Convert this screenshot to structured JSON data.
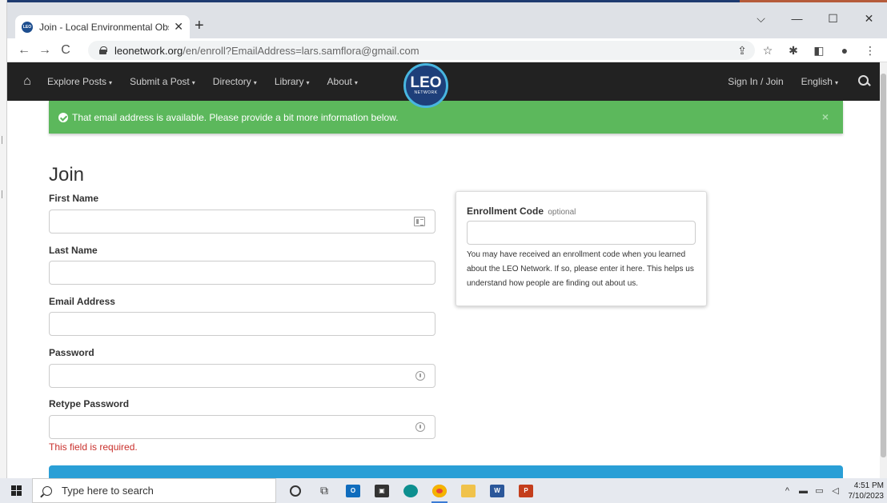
{
  "browser": {
    "tab_title": "Join - Local Environmental Obser",
    "tab_close": "✕",
    "new_tab": "+",
    "url_host": "leonetwork.org",
    "url_path": "/en/enroll?EmailAddress=lars.samflora@gmail.com",
    "controls": {
      "dropdown": "⌵",
      "minimize": "—",
      "maximize": "☐",
      "close": "✕"
    },
    "nav": {
      "back": "←",
      "forward": "→",
      "reload": "C"
    },
    "favicon_text": "LEO"
  },
  "site_nav": {
    "items": [
      {
        "label": "Explore Posts"
      },
      {
        "label": "Submit a Post"
      },
      {
        "label": "Directory"
      },
      {
        "label": "Library"
      },
      {
        "label": "About"
      }
    ],
    "logo_main": "LEO",
    "logo_sub": "NETWORK",
    "sign_in": "Sign In / Join",
    "language": "English",
    "caret": "▾"
  },
  "alert": {
    "message": "That email address is available. Please provide a bit more information below.",
    "close": "×",
    "color": "#5cb85c"
  },
  "form": {
    "title": "Join",
    "first_name_label": "First Name",
    "last_name_label": "Last Name",
    "email_label": "Email Address",
    "password_label": "Password",
    "retype_password_label": "Retype Password",
    "error": "This field is required.",
    "first_name_value": "",
    "last_name_value": "",
    "email_value": "",
    "password_value": "",
    "retype_password_value": ""
  },
  "enrollment": {
    "label": "Enrollment Code",
    "optional": "optional",
    "value": "",
    "help": "You may have received an enrollment code when you learned about the LEO Network. If so, please enter it here. This helps us understand how people are finding out about us."
  },
  "taskbar": {
    "search_placeholder": "Type here to search",
    "time": "4:51 PM",
    "date": "7/10/2023",
    "apps": [
      "cortana",
      "task-view",
      "outlook",
      "store",
      "edge",
      "chrome",
      "file-explorer",
      "word",
      "powerpoint"
    ]
  },
  "colors": {
    "navbar": "#222222",
    "accent_blue": "#2a9fd6",
    "error_red": "#c9302c",
    "logo_blue": "#1e3f7a"
  }
}
